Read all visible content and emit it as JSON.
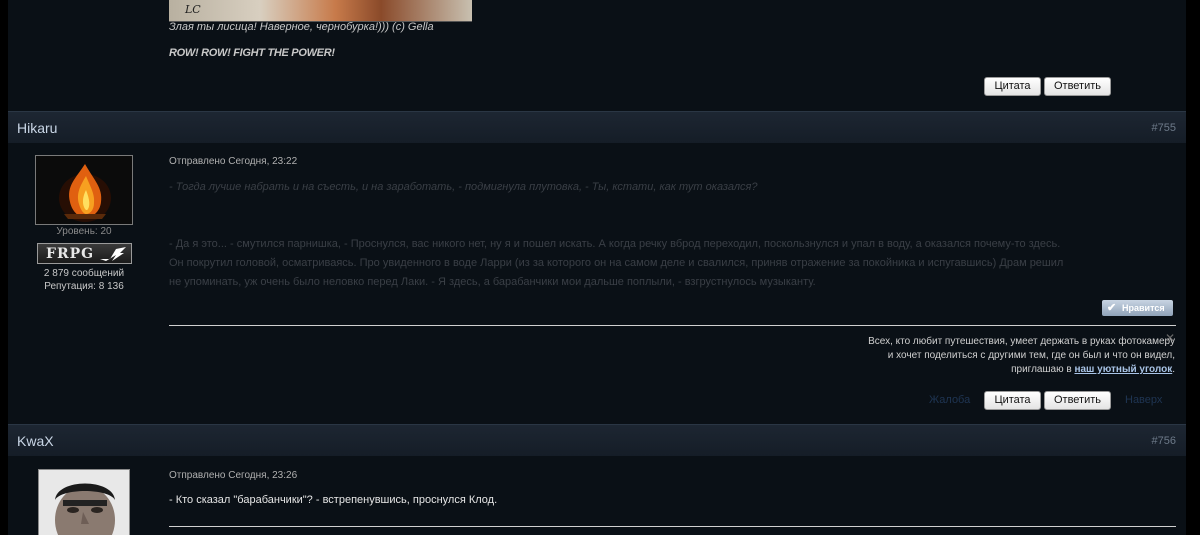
{
  "prev_post": {
    "banner_text": "LC",
    "signature_line1": "Злая ты лисица! Наверное, чернобурка!))) (с) Gella",
    "signature_line2": "ROW! ROW! FIGHT THE POWER!",
    "quote_button": "Цитата",
    "reply_button": "Ответить"
  },
  "posts": [
    {
      "author": "Hikaru",
      "number": "#755",
      "level": "Уровень: 20",
      "badge": "FRPG",
      "message_count": "2 879 сообщений",
      "reputation": "Репутация: 8 136",
      "posted": "Отправлено Сегодня, 23:22",
      "paragraph1": "- Тогда лучше набрать и на съесть, и на заработать, - подмигнула плутовка, - Ты, кстати, как тут оказался?",
      "paragraph2_line1": "- Да я это... - смутился парнишка, - Проснулся, вас никого нет, ну я и пошел искать. А когда речку вброд переходил, поскользнулся и упал в воду, а оказался почему-то здесь.",
      "paragraph2_line2": "Он покрутил головой, осматриваясь. Про увиденного в воде Ларри (из за которого он на самом деле и свалился, приняв отражение за покойника и испугавшись) Драм решил",
      "paragraph2_line3": "не упоминать, уж очень было неловко перед Лаки. - Я здесь, а барабанчики мои дальше поплыли, - взгрустнулось музыканту.",
      "like_button": "Нравится",
      "signature_line1": "Всех, кто любит путешествия, умеет держать в руках фотокамеру",
      "signature_line2": "и хочет поделиться с другими тем, где он был и что он видел,",
      "signature_line3_prefix": "приглашаю в ",
      "signature_link": "наш уютный уголок",
      "signature_line3_suffix": ".",
      "report_link": "Жалоба",
      "quote_button": "Цитата",
      "reply_button": "Ответить",
      "top_link": "Наверх"
    },
    {
      "author": "KwaX",
      "number": "#756",
      "posted": "Отправлено Сегодня, 23:26",
      "message": "- Кто сказал \"барабанчики\"? - встрепенувшись, проснулся Клод."
    }
  ],
  "icons": {
    "close": "close-icon",
    "check": "check-icon"
  }
}
